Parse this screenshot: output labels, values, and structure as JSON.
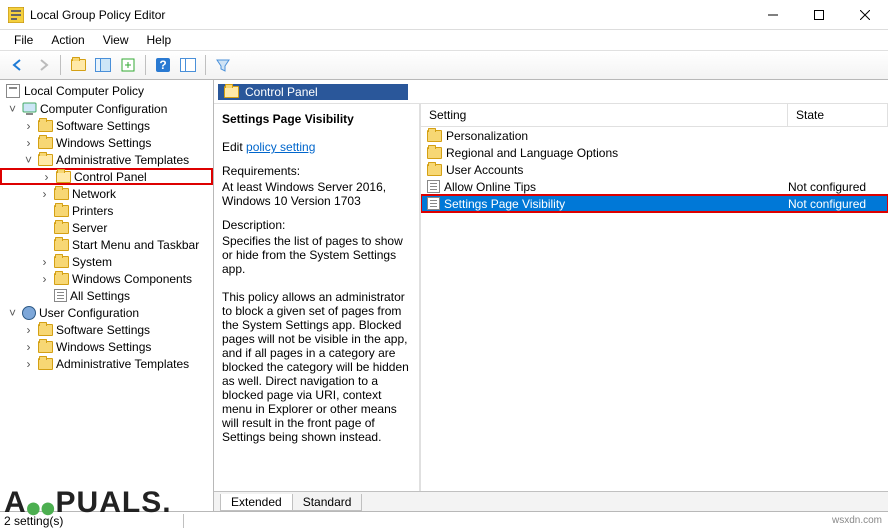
{
  "window": {
    "title": "Local Group Policy Editor"
  },
  "menubar": [
    "File",
    "Action",
    "View",
    "Help"
  ],
  "tree": {
    "root": "Local Computer Policy",
    "computer": "Computer Configuration",
    "computer_children": [
      "Software Settings",
      "Windows Settings",
      "Administrative Templates"
    ],
    "admin_children": [
      "Control Panel",
      "Network",
      "Printers",
      "Server",
      "Start Menu and Taskbar",
      "System",
      "Windows Components",
      "All Settings"
    ],
    "user": "User Configuration",
    "user_children": [
      "Software Settings",
      "Windows Settings",
      "Administrative Templates"
    ]
  },
  "pathbar": {
    "label": "Control Panel"
  },
  "desc": {
    "heading": "Settings Page Visibility",
    "edit_label": "Edit ",
    "edit_link": "policy setting",
    "req_label": "Requirements:",
    "req_text": "At least Windows Server 2016, Windows 10 Version 1703",
    "desc_label": "Description:",
    "desc_text": "Specifies the list of pages to show or hide from the System Settings app.",
    "desc_text2": "This policy allows an administrator to block a given set of pages from the System Settings app. Blocked pages will not be visible in the app, and if all pages in a category are blocked the category will be hidden as well. Direct navigation to a blocked page via URI, context menu in Explorer or other means will result in the front page of Settings being shown instead."
  },
  "list": {
    "col_setting": "Setting",
    "col_state": "State",
    "rows": [
      {
        "type": "folder",
        "label": "Personalization",
        "state": ""
      },
      {
        "type": "folder",
        "label": "Regional and Language Options",
        "state": ""
      },
      {
        "type": "folder",
        "label": "User Accounts",
        "state": ""
      },
      {
        "type": "setting",
        "label": "Allow Online Tips",
        "state": "Not configured"
      },
      {
        "type": "setting",
        "label": "Settings Page Visibility",
        "state": "Not configured",
        "selected": true,
        "boxed": true
      }
    ]
  },
  "tabs": {
    "extended": "Extended",
    "standard": "Standard"
  },
  "status": {
    "count": "2 setting(s)"
  },
  "watermark": {
    "text": "A   PUALS.",
    "credit": "wsxdn.com"
  }
}
